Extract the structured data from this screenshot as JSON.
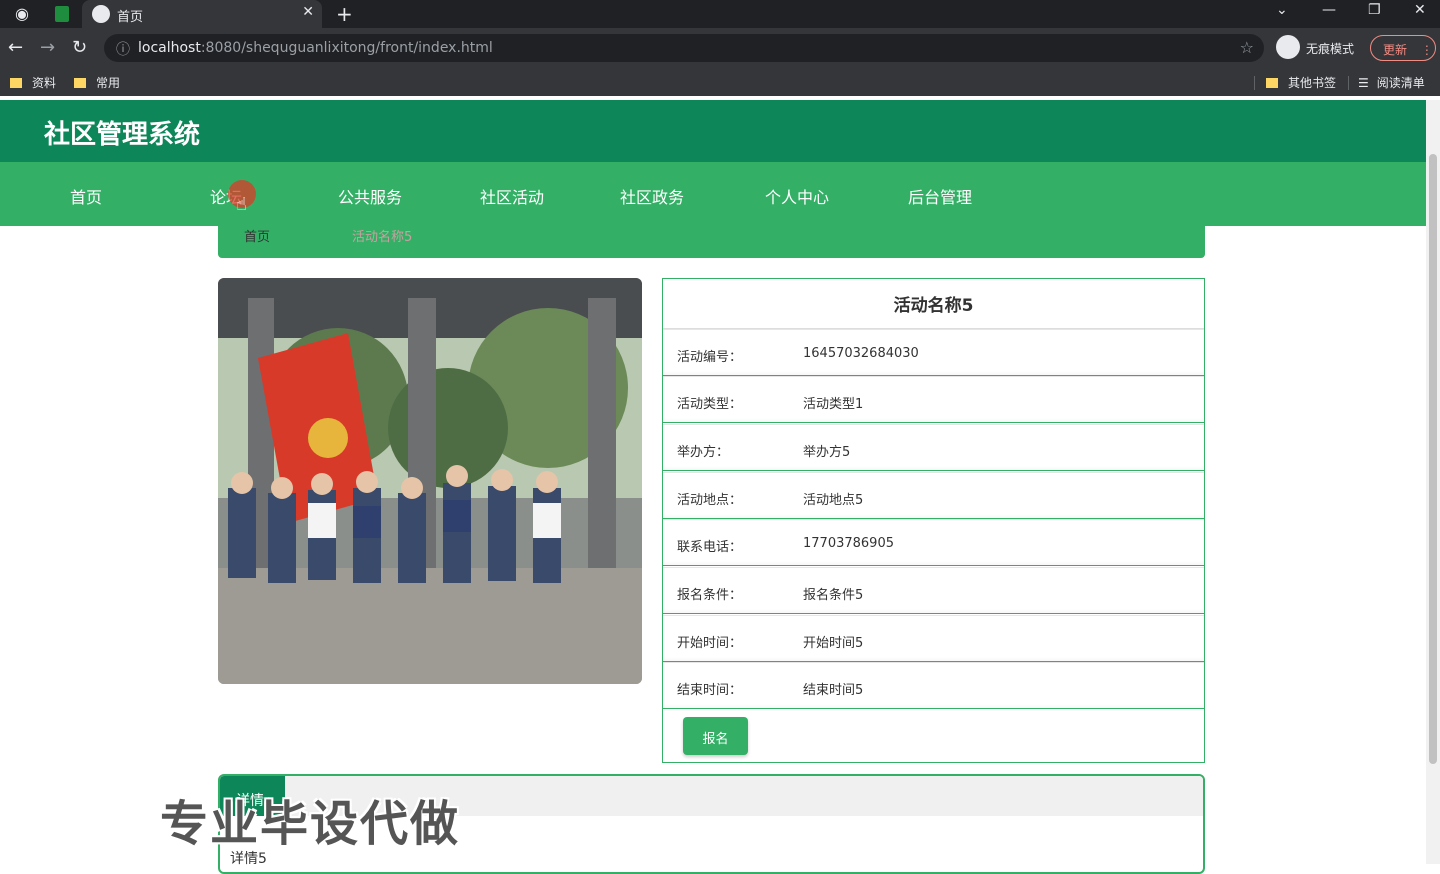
{
  "browser": {
    "tab_title": "首页",
    "url_host": "localhost",
    "url_path": ":8080/shequguanlixitong/front/index.html",
    "incognito_label": "无痕模式",
    "update_label": "更新",
    "bookmarks": [
      "资料",
      "常用",
      "其他书签",
      "阅读清单"
    ]
  },
  "site": {
    "title": "社区管理系统",
    "nav": [
      "首页",
      "论坛",
      "公共服务",
      "社区活动",
      "社区政务",
      "个人中心",
      "后台管理"
    ]
  },
  "breadcrumb": [
    "首页",
    "活动名称5"
  ],
  "activity": {
    "title": "活动名称5",
    "fields": [
      {
        "label": "活动编号：",
        "value": "16457032684030"
      },
      {
        "label": "活动类型：",
        "value": "活动类型1"
      },
      {
        "label": "举办方：",
        "value": "举办方5"
      },
      {
        "label": "活动地点：",
        "value": "活动地点5"
      },
      {
        "label": "联系电话：",
        "value": "17703786905"
      },
      {
        "label": "报名条件：",
        "value": "报名条件5"
      },
      {
        "label": "开始时间：",
        "value": "开始时间5"
      },
      {
        "label": "结束时间：",
        "value": "结束时间5"
      }
    ],
    "signup_label": "报名"
  },
  "details": {
    "tab_label": "详情",
    "content": "详情5"
  },
  "watermark": "专业毕设代做",
  "colors": {
    "header": "#0d875a",
    "nav": "#33b066",
    "accent": "#33b066"
  }
}
